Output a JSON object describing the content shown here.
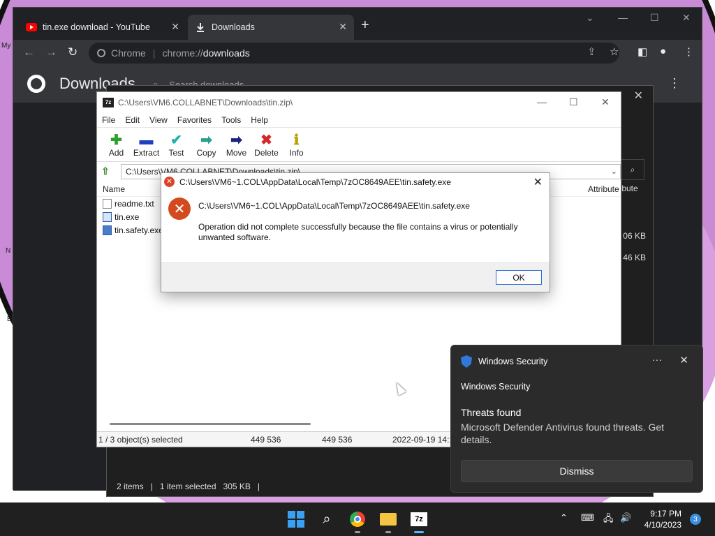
{
  "desktop": {
    "fragments": [
      "My",
      "N",
      "E"
    ]
  },
  "chrome": {
    "tabs": [
      {
        "label": "tin.exe download - YouTube",
        "icon": "youtube-icon"
      },
      {
        "label": "Downloads",
        "icon": "download-icon"
      }
    ],
    "omnibox": {
      "scheme_label": "Chrome",
      "url_prefix": "chrome://",
      "url_host": "downloads"
    },
    "page_title": "Downloads",
    "search_placeholder": "Search downloads"
  },
  "explorer": {
    "attributes_col": "Attribute",
    "sizes": [
      "06 KB",
      "46 KB"
    ],
    "status": {
      "items": "2 items",
      "selected": "1 item selected",
      "size": "305 KB"
    }
  },
  "sevenzip": {
    "title": "C:\\Users\\VM6.COLLABNET\\Downloads\\tin.zip\\",
    "app_icon": "7z",
    "menu": [
      "File",
      "Edit",
      "View",
      "Favorites",
      "Tools",
      "Help"
    ],
    "toolbar": [
      {
        "label": "Add",
        "icon": "plus-icon",
        "color": "#2ca02c"
      },
      {
        "label": "Extract",
        "icon": "minus-icon",
        "color": "#1f3fbf"
      },
      {
        "label": "Test",
        "icon": "check-icon",
        "color": "#20b2aa"
      },
      {
        "label": "Copy",
        "icon": "copy-arrow-icon",
        "color": "#2a9d8f"
      },
      {
        "label": "Move",
        "icon": "move-arrow-icon",
        "color": "#1a237e"
      },
      {
        "label": "Delete",
        "icon": "delete-x-icon",
        "color": "#d62728"
      },
      {
        "label": "Info",
        "icon": "info-icon",
        "color": "#b8a000"
      }
    ],
    "address": "C:\\Users\\VM6.COLLABNET\\Downloads\\tin.zip\\",
    "columns": {
      "name": "Name",
      "attributes": "Attribute"
    },
    "files": [
      {
        "name": "readme.txt",
        "type": "txt"
      },
      {
        "name": "tin.exe",
        "type": "exe"
      },
      {
        "name": "tin.safety.exe",
        "type": "exe"
      }
    ],
    "status": {
      "selection": "1 / 3 object(s) selected",
      "size": "449 536",
      "packed": "449 536",
      "modified": "2022-09-19 14:1"
    }
  },
  "error_dialog": {
    "title": "C:\\Users\\VM6~1.COL\\AppData\\Local\\Temp\\7zOC8649AEE\\tin.safety.exe",
    "path": "C:\\Users\\VM6~1.COL\\AppData\\Local\\Temp\\7zOC8649AEE\\tin.safety.exe",
    "message": "Operation did not complete successfully because the file contains a virus or potentially unwanted software.",
    "ok_label": "OK"
  },
  "toast": {
    "header": "Windows Security",
    "more_label": "···",
    "app_name": "Windows Security",
    "heading": "Threats found",
    "body": "Microsoft Defender Antivirus found threats. Get details.",
    "dismiss_label": "Dismiss"
  },
  "taskbar": {
    "time": "9:17 PM",
    "date": "4/10/2023",
    "notifications": "3"
  }
}
